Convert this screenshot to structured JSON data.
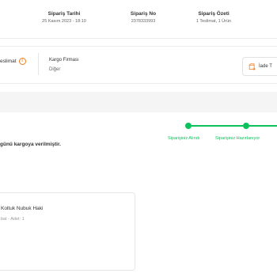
{
  "order_info": {
    "date_label": "Sipariş Tarihi",
    "date_value": "25 Kasım 2023 - 18:10",
    "no_label": "Sipariş No",
    "no_value": "2378333993",
    "summary_label": "Sipariş Özeti",
    "summary_value": "1 Teslimat, 1 Ürün"
  },
  "delivery": {
    "teslimat_label": "eslimat",
    "cargo_label": "Kargo Firması",
    "cargo_value": "Diğer",
    "return_button_label": "İade T"
  },
  "shipment": {
    "status_text": "günü kargoya verilmiştir.",
    "steps": [
      "Siparişiniz Alındı",
      "Siparişiniz Hazırlanıyor"
    ],
    "accent_color": "#0bc15c"
  },
  "product": {
    "name": "Koltuk Nubuk Haki",
    "meta": "bat - Adet: 1"
  },
  "colors": {
    "info_icon": "#f27a1a"
  }
}
